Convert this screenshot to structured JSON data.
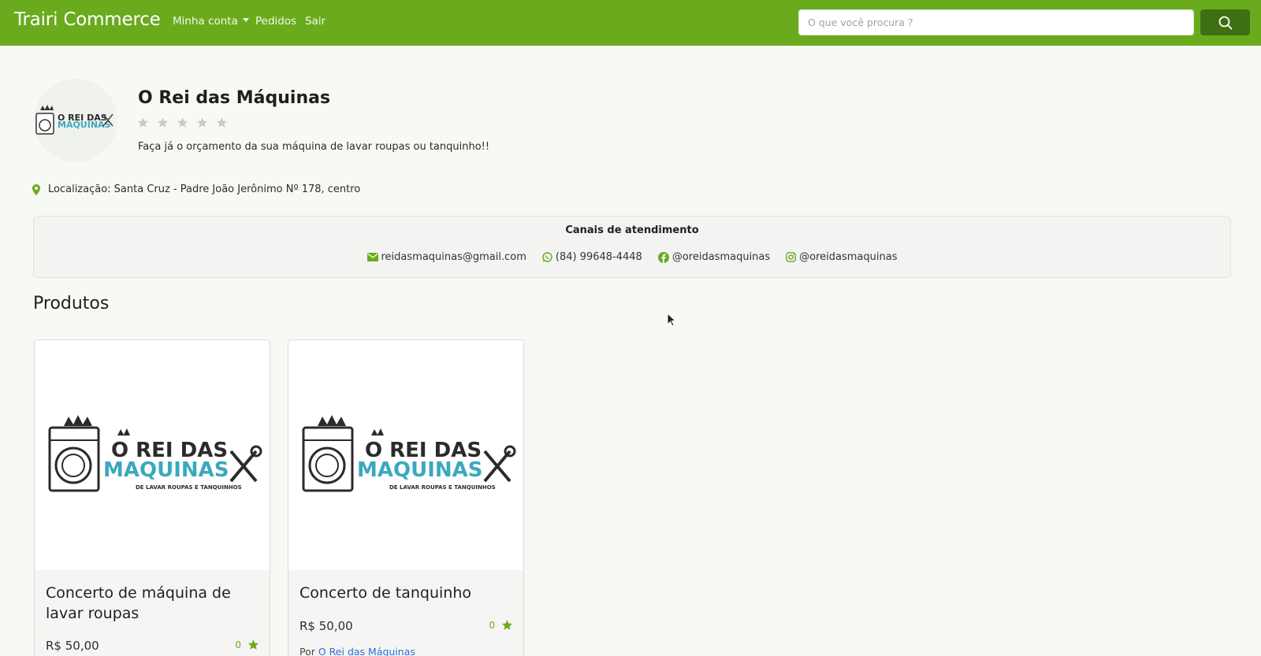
{
  "navbar": {
    "brand": "Trairi Commerce",
    "account_label": "Minha conta",
    "orders_label": "Pedidos",
    "exit_label": "Sair",
    "search_placeholder": "O que você procura ?",
    "search_icon": "search-icon",
    "background_color": "#6aab1e",
    "button_color": "#3d7012"
  },
  "store": {
    "name": "O Rei das Máquinas",
    "rating_stars": 0,
    "rating_max": 5,
    "description": "Faça já o orçamento da sua máquina de lavar roupas ou tanquinho!!",
    "location": "Localização: Santa Cruz - Padre João Jerônimo Nº 178, centro",
    "logo_text": {
      "line1": "O REI DAS",
      "line2": "MAQUINAS",
      "line3": "DE LAVAR ROUPAS E TANQUINHOS"
    }
  },
  "channels": {
    "title": "Canais de atendimento",
    "email": "reidasmaquinas@gmail.com",
    "whatsapp": "(84) 99648-4448",
    "facebook": "@oreidasmaquinas",
    "instagram": "@oreidasmaquinas"
  },
  "products": {
    "section_title": "Produtos",
    "items": [
      {
        "title": "Concerto de máquina de lavar roupas",
        "price": "R$ 50,00",
        "rating": "0"
      },
      {
        "title": "Concerto de tanquinho",
        "price": "R$ 50,00",
        "rating": "0",
        "by_prefix": "Por",
        "by_store": "O Rei das Máquinas"
      }
    ]
  }
}
